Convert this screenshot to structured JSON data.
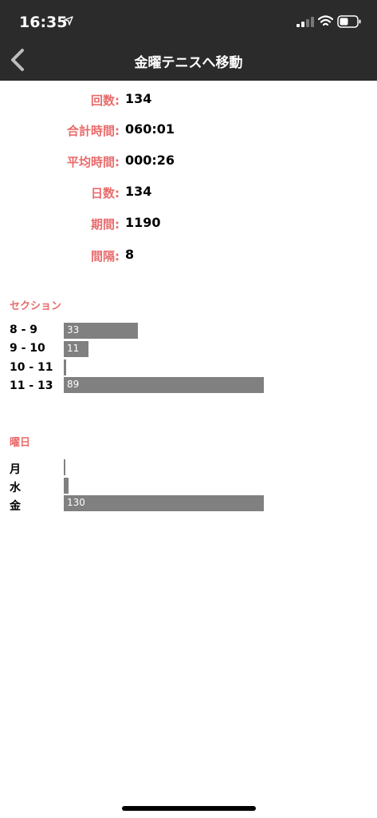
{
  "status_bar": {
    "time": "16:35"
  },
  "nav": {
    "title": "金曜テニスへ移動"
  },
  "stats": [
    {
      "label": "回数:",
      "value": "134"
    },
    {
      "label": "合計時間:",
      "value": "060:01"
    },
    {
      "label": "平均時間:",
      "value": "000:26"
    },
    {
      "label": "日数:",
      "value": "134"
    },
    {
      "label": "期間:",
      "value": "1190"
    },
    {
      "label": "間隔:",
      "value": "8"
    }
  ],
  "chart_data": [
    {
      "type": "bar",
      "title": "セクション",
      "categories": [
        "8 - 9",
        "9 - 10",
        "10 - 11",
        "11 - 13"
      ],
      "values": [
        33,
        11,
        1,
        89
      ],
      "value_labels": [
        "33",
        "11",
        "",
        "89"
      ],
      "max": 89,
      "colors": {
        "bar": "#808080",
        "label": "#ffffff"
      }
    },
    {
      "type": "bar",
      "title": "曜日",
      "categories": [
        "月",
        "水",
        "金"
      ],
      "values": [
        1,
        3,
        130
      ],
      "value_labels": [
        "",
        "",
        "130"
      ],
      "max": 130,
      "colors": {
        "bar": "#808080",
        "label": "#ffffff"
      }
    }
  ],
  "colors": {
    "accent": "#e96b6b",
    "header_bg": "#2b2b2b"
  }
}
